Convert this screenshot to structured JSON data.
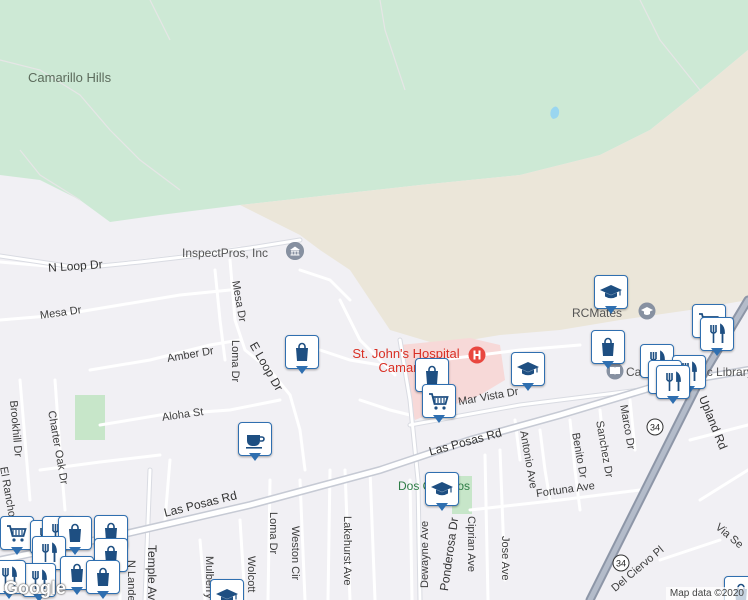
{
  "map": {
    "area_labels": [
      "Camarillo Hills"
    ],
    "place_labels": [
      "InspectPros, Inc",
      "RCMates",
      "Camarillo Public Library"
    ],
    "hospital_label": "St. John's Hospital Camarillo",
    "park_label": "Dos Caminos",
    "roads": [
      "N Loop Dr",
      "Mesa Dr",
      "Amber Dr",
      "E Loop Dr",
      "Loma Dr",
      "Aloha St",
      "Brookhill Dr",
      "Charter Oak Dr",
      "El Rancho",
      "Las Posas Rd",
      "Lakehurst Ave",
      "Weston Cir",
      "Dewayne Ave",
      "Ponderosa Dr",
      "Ciprian Ave",
      "Jose Ave",
      "Antonio Ave",
      "Benito Dr",
      "Sanchez Dr",
      "Marco Dr",
      "Fortuna Ave",
      "Mar Vista Dr",
      "Upland Rd",
      "Del Ciervo Pl",
      "Via Se",
      "Temple Ave",
      "N Lander",
      "Mulberry",
      "Wolcott"
    ],
    "route_shields": [
      "34"
    ],
    "colors": {
      "hills": "#cde9d5",
      "urban_bg": "#f1f0f4",
      "sand": "#ebe6d9",
      "hospital": "#f7d9d8",
      "park": "#c7e6c9",
      "water": "#9ad6f0",
      "pin_border": "#2f6fb0",
      "icon": "#1e4f82",
      "hospital_red": "#e9473f"
    },
    "attribution": "Map data ©2020",
    "logo": "Google",
    "marker_types": [
      "shopping-bag",
      "coffee",
      "graduation-cap",
      "grocery-cart",
      "restaurant",
      "library"
    ]
  }
}
